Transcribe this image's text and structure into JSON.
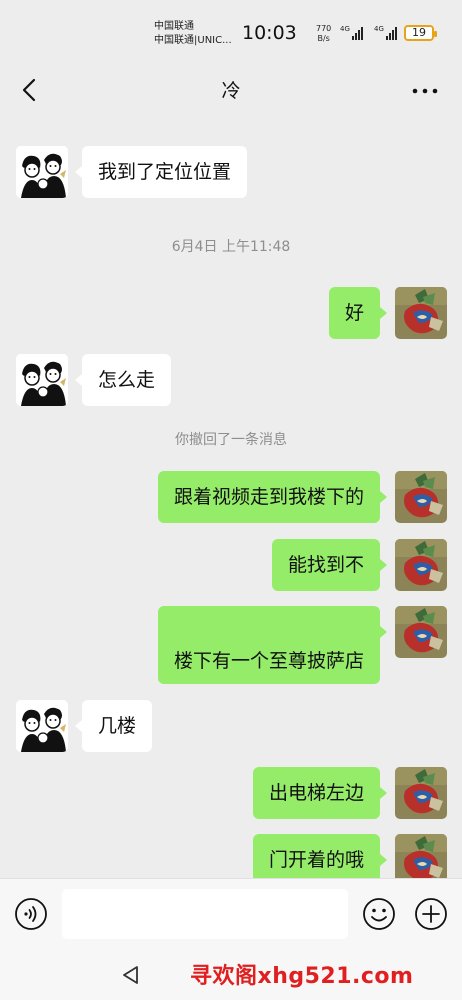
{
  "status_bar": {
    "carrier_1": "中国联通",
    "carrier_2": "中国联通|UNIC...",
    "time": "10:03",
    "net_speed_value": "770",
    "net_speed_unit": "B/s",
    "signal_1_label": "4G",
    "signal_2_label": "4G",
    "battery": "19",
    "battery_color": "#e8a31a"
  },
  "header": {
    "title": "冷",
    "back_icon": "chevron-left-icon",
    "more_icon": "more-dots-icon"
  },
  "messages": [
    {
      "side": "in",
      "text": "我到了定位位置"
    },
    {
      "side": "in",
      "text": "怎么走"
    },
    {
      "side": "in",
      "text": "几楼"
    }
  ],
  "outgoing": [
    {
      "side": "out",
      "text": "好"
    },
    {
      "side": "out",
      "text": "跟着视频走到我楼下的"
    },
    {
      "side": "out",
      "text": "能找到不"
    },
    {
      "side": "out",
      "text": "楼下有一个至尊披萨店"
    },
    {
      "side": "out",
      "text": "出电梯左边"
    },
    {
      "side": "out",
      "text": "门开着的哦"
    }
  ],
  "system": {
    "timestamp": "6月4日 上午11:48",
    "recall_notice": "你撤回了一条消息"
  },
  "input_bar": {
    "placeholder": "",
    "voice_icon": "voice-icon",
    "emoji_icon": "emoji-icon",
    "plus_icon": "plus-icon"
  },
  "nav_bar": {
    "back_icon": "triangle-back-icon",
    "watermark": "寻欢阁xhg521.com"
  },
  "colors": {
    "background": "#ededed",
    "incoming_bubble": "#ffffff",
    "outgoing_bubble": "#95ec69",
    "watermark": "#e02020"
  }
}
